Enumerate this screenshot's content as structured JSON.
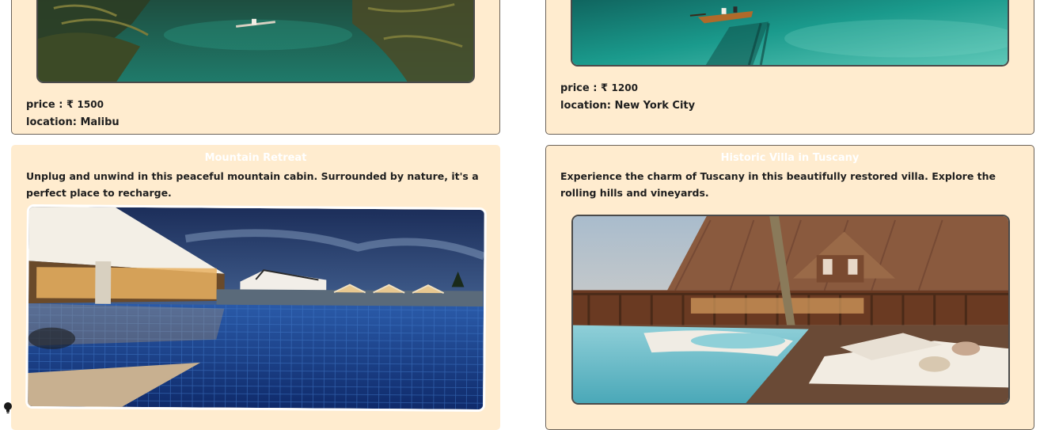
{
  "cards": [
    {
      "title": "",
      "description": "",
      "price_label": "price : ₹",
      "price_value": "1500",
      "location": "location: Malibu",
      "image": "tropical-lagoon-canoe-photo"
    },
    {
      "title": "",
      "description": "",
      "price_label": "price : ₹",
      "price_value": "1200",
      "location": "location: New York City",
      "image": "turquoise-sea-boat-photo"
    },
    {
      "title": "Mountain Retreat",
      "description": "Unplug and unwind in this peaceful mountain cabin. Surrounded by nature, it's a perfect place to recharge.",
      "image": "resort-pool-dusk-photo"
    },
    {
      "title": "Historic Villa in Tuscany",
      "description": "Experience the charm of Tuscany in this beautifully restored villa. Explore the rolling hills and vineyards.",
      "image": "wooden-lodge-pool-deck-photo"
    }
  ],
  "colors": {
    "card_background": "#ffeccf",
    "card_border": "#6b6258",
    "title_text": "#ffffff",
    "body_text": "#1f1f1f"
  },
  "icons": {
    "bottom_left": "lightbulb-icon"
  }
}
